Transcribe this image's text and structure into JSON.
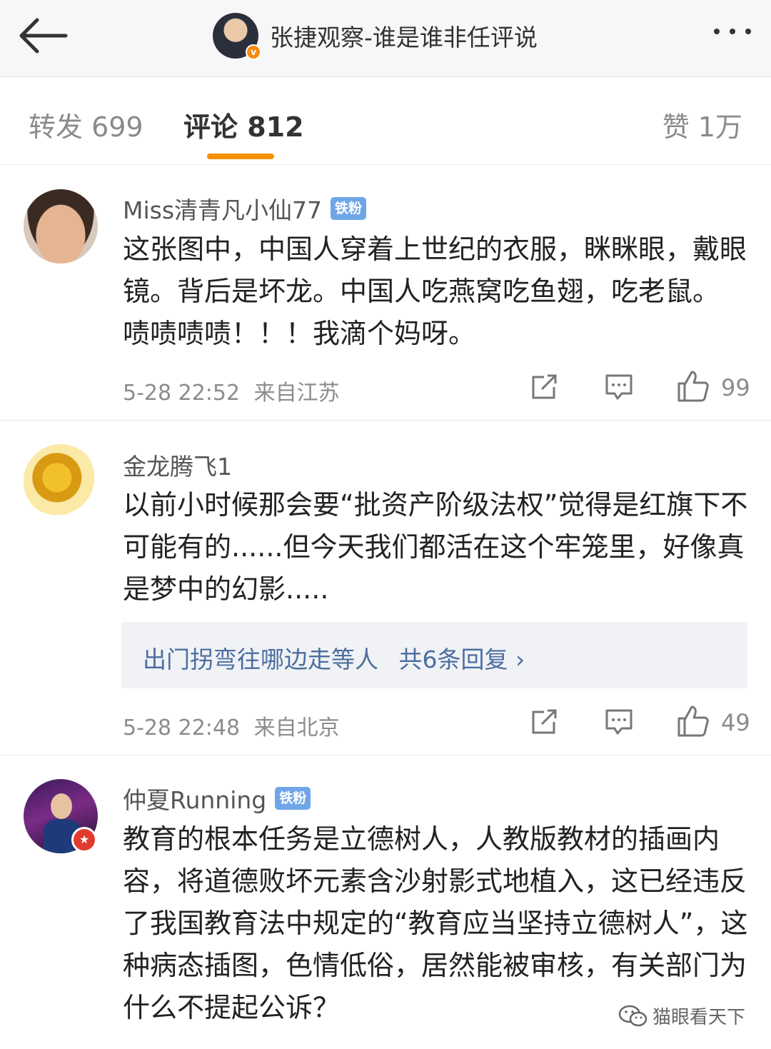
{
  "header": {
    "back_icon": "arrow-left-icon",
    "title": "张捷观察-谁是谁非任评说",
    "verified_badge": "v",
    "more_icon": "more-dots-icon"
  },
  "tabs": {
    "repost": "转发 699",
    "comments": "评论 812",
    "likes": "赞 1万",
    "active_color": "#f79000"
  },
  "comments": [
    {
      "username": "Miss清青凡小仙77",
      "badge": "铁粉",
      "text": "这张图中，中国人穿着上世纪的衣服，眯眯眼，戴眼镜。背后是坏龙。中国人吃燕窝吃鱼翅，吃老鼠。 啧啧啧啧！！！我滴个妈呀。",
      "time": "5-28 22:52",
      "location": "来自江苏",
      "likes": "99"
    },
    {
      "username": "金龙腾飞1",
      "text": "以前小时候那会要“批资产阶级法权”觉得是红旗下不可能有的......但今天我们都活在这个牢笼里，好像真是梦中的幻影.....",
      "reply_preview": "出门拐弯往哪边走等人",
      "reply_count": "共6条回复 ›",
      "time": "5-28 22:48",
      "location": "来自北京",
      "likes": "49"
    },
    {
      "username": "仲夏Running",
      "badge": "铁粉",
      "text": "教育的根本任务是立德树人，人教版教材的插画内容，将道德败坏元素含沙射影式地植入，这已经违反了我国教育法中规定的“教育应当坚持立德树人”，这种病态插图，色情低俗，居然能被审核，有关部门为什么不提起公诉？"
    }
  ],
  "watermark": {
    "text": "猫眼看天下",
    "icon": "wechat-icon"
  }
}
